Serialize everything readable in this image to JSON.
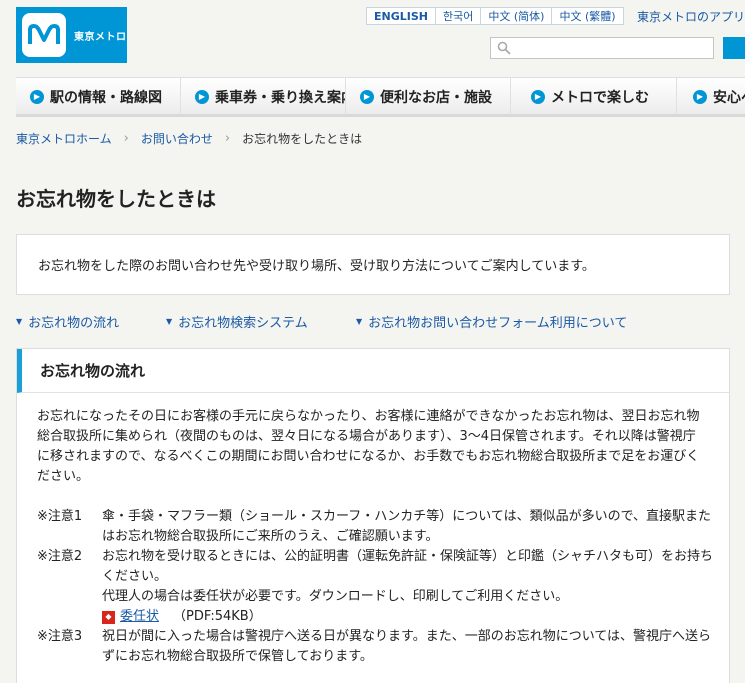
{
  "header": {
    "logo_text": "東京メトロ",
    "languages": [
      "ENGLISH",
      "한국어",
      "中文 (简体)",
      "中文 (繁體)"
    ],
    "app_link": "東京メトロのアプリ",
    "search_placeholder": ""
  },
  "gnav": {
    "items": [
      {
        "label": "駅の情報・路線図"
      },
      {
        "label": "乗車券・乗り換え案内"
      },
      {
        "label": "便利なお店・施設"
      },
      {
        "label": "メトロで楽しむ"
      },
      {
        "label": "安心へ"
      }
    ]
  },
  "breadcrumb": {
    "home": "東京メトロホーム",
    "contact": "お問い合わせ",
    "current": "お忘れ物をしたときは"
  },
  "page": {
    "title": "お忘れ物をしたときは",
    "intro": "お忘れ物をした際のお問い合わせ先や受け取り場所、受け取り方法についてご案内しています。"
  },
  "anchors": [
    "お忘れ物の流れ",
    "お忘れ物検索システム",
    "お忘れ物お問い合わせフォーム利用について"
  ],
  "section": {
    "title": "お忘れ物の流れ",
    "paragraph": "お忘れになったその日にお客様の手元に戻らなかったり、お客様に連絡ができなかったお忘れ物は、翌日お忘れ物総合取扱所に集められ（夜間のものは、翌々日になる場合があります）、3〜4日保管されます。それ以降は警視庁に移されますので、なるべくこの期間にお問い合わせになるか、お手数でもお忘れ物総合取扱所まで足をお運びください。",
    "notes": [
      {
        "label": "※注意1",
        "text": "傘・手袋・マフラー類（ショール・スカーフ・ハンカチ等）については、類似品が多いので、直接駅またはお忘れ物総合取扱所にご来所のうえ、ご確認願います。"
      },
      {
        "label": "※注意2",
        "text": "お忘れ物を受け取るときには、公的証明書（運転免許証・保険証等）と印鑑（シャチハタも可）をお持ちください。",
        "extra": "代理人の場合は委任状が必要です。ダウンロードし、印刷してご利用ください。",
        "pdf_label": "委任状",
        "pdf_info": "（PDF:54KB）"
      },
      {
        "label": "※注意3",
        "text": "祝日が間に入った場合は警視庁へ送る日が異なります。また、一部のお忘れ物については、警視庁へ送らずにお忘れ物総合取扱所で保管しております。"
      }
    ]
  },
  "colors": {
    "brand": "#0096d6",
    "link": "#1a5aa6",
    "pdf": "#d9261c"
  }
}
